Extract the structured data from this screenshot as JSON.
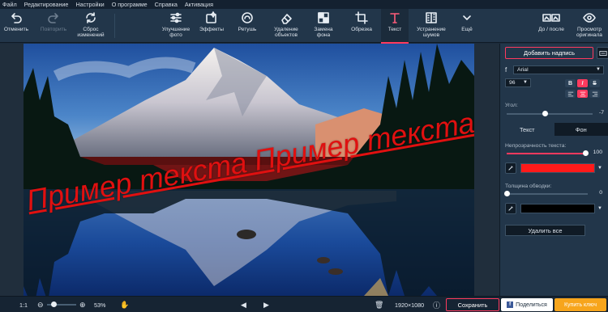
{
  "menu": [
    "Файл",
    "Редактирование",
    "Настройки",
    "О программе",
    "Справка",
    "Активация"
  ],
  "toolbar": {
    "undo": "Отменить",
    "redo": "Повторить",
    "reset": "Сброс\nизменений",
    "enhance": "Улучшение\nфото",
    "effects": "Эффекты",
    "retouch": "Ретушь",
    "remove_objects": "Удаление\nобъектов",
    "replace_bg": "Замена\nфона",
    "crop": "Обрезка",
    "text": "Текст",
    "denoise": "Устранение\nшумов",
    "more": "Ещё",
    "before_after": "До / после",
    "view_original": "Просмотр\nоригинала"
  },
  "canvas": {
    "sample_text": "Пример текста Пример текста"
  },
  "panel": {
    "add_text": "Добавить надпись",
    "font": "Arial",
    "font_size": "96",
    "bold": "B",
    "italic": "I",
    "strike": "S",
    "angle_label": "Угол:",
    "angle_value": "-7",
    "tab_text": "Текст",
    "tab_bg": "Фон",
    "opacity_label": "Непрозрачность текста:",
    "opacity_value": "100",
    "text_color": "#ff1a1a",
    "stroke_label": "Толщина обводки:",
    "stroke_value": "0",
    "stroke_color": "#000000",
    "delete_all": "Удалить все"
  },
  "status": {
    "ratio": "1:1",
    "zoom": "53%",
    "dimensions": "1920×1080",
    "save": "Сохранить",
    "share": "Поделиться",
    "buy": "Купить ключ"
  }
}
